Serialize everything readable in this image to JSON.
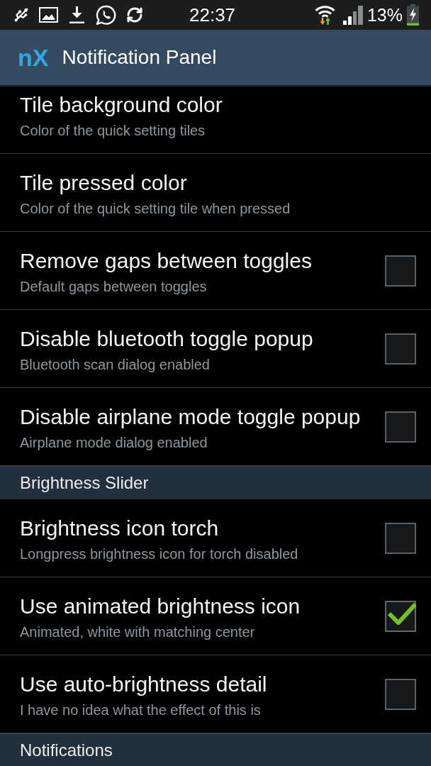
{
  "status_bar": {
    "time": "22:37",
    "battery": "13%"
  },
  "action_bar": {
    "logo": "nX",
    "title": "Notification Panel"
  },
  "list": [
    {
      "kind": "preference",
      "title": "Tile background color",
      "summary": "Color of the quick setting tiles"
    },
    {
      "kind": "preference",
      "title": "Tile pressed color",
      "summary": "Color of the quick setting tile when pressed"
    },
    {
      "kind": "checkbox",
      "title": "Remove gaps between toggles",
      "summary": "Default gaps between toggles",
      "checked": false
    },
    {
      "kind": "checkbox",
      "title": "Disable bluetooth toggle popup",
      "summary": "Bluetooth scan dialog enabled",
      "checked": false
    },
    {
      "kind": "checkbox",
      "title": "Disable airplane mode toggle popup",
      "summary": "Airplane mode dialog enabled",
      "checked": false
    },
    {
      "kind": "header",
      "title": "Brightness Slider"
    },
    {
      "kind": "checkbox",
      "title": "Brightness icon torch",
      "summary": "Longpress brightness icon for torch disabled",
      "checked": false
    },
    {
      "kind": "checkbox",
      "title": "Use animated brightness icon",
      "summary": "Animated, white with matching center",
      "checked": true
    },
    {
      "kind": "checkbox",
      "title": "Use auto-brightness detail",
      "summary": "I have no idea what the effect of this is",
      "checked": false
    },
    {
      "kind": "header",
      "title": "Notifications"
    }
  ]
}
